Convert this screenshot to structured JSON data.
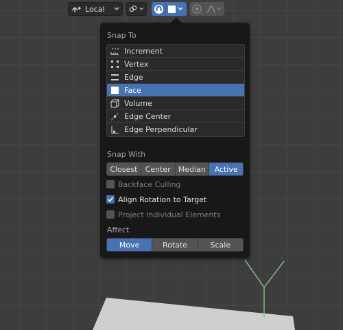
{
  "header": {
    "pivot_label": "Local",
    "colors": {
      "accent": "#4772b3",
      "button": "#2b2b2b"
    }
  },
  "popover": {
    "snap_to_label": "Snap To",
    "snap_to_items": [
      {
        "label": "Increment",
        "icon": "increment-icon",
        "active": false
      },
      {
        "label": "Vertex",
        "icon": "vertex-icon",
        "active": false
      },
      {
        "label": "Edge",
        "icon": "edge-icon",
        "active": false
      },
      {
        "label": "Face",
        "icon": "face-icon",
        "active": true
      },
      {
        "label": "Volume",
        "icon": "volume-icon",
        "active": false
      },
      {
        "label": "Edge Center",
        "icon": "edge-center-icon",
        "active": false
      },
      {
        "label": "Edge Perpendicular",
        "icon": "edge-perpendicular-icon",
        "active": false
      }
    ],
    "snap_with_label": "Snap With",
    "snap_with_options": [
      "Closest",
      "Center",
      "Median",
      "Active"
    ],
    "snap_with_selected": "Active",
    "options": [
      {
        "label": "Backface Culling",
        "checked": false
      },
      {
        "label": "Align Rotation to Target",
        "checked": true
      },
      {
        "label": "Project Individual Elements",
        "checked": false
      }
    ],
    "affect_label": "Affect",
    "affect_options": [
      "Move",
      "Rotate",
      "Scale"
    ],
    "affect_selected": "Move"
  }
}
